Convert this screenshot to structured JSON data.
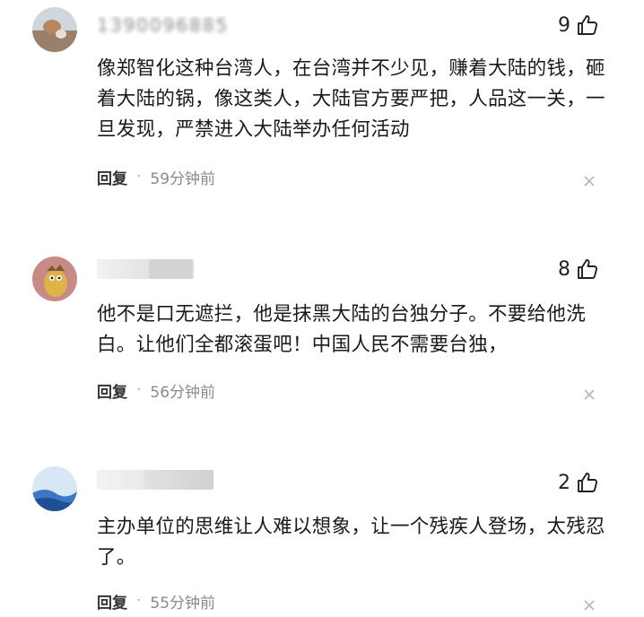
{
  "comments": [
    {
      "username": "1390096885",
      "likes": "9",
      "text": "像郑智化这种台湾人，在台湾并不少见，赚着大陆的钱，砸着大陆的锅，像这类人，大陆官方要严把，人品这一关，一旦发现，严禁进入大陆举办任何活动",
      "reply_label": "回复",
      "separator": "·",
      "time": "59分钟前"
    },
    {
      "username": "",
      "likes": "8",
      "text": "他不是口无遮拦，他是抹黑大陆的台独分子。不要给他洗白。让他们全都滚蛋吧！中国人民不需要台独，",
      "reply_label": "回复",
      "separator": "·",
      "time": "56分钟前"
    },
    {
      "username": "",
      "likes": "2",
      "text": "主办单位的思维让人难以想象，让一个残疾人登场，太残忍了。",
      "reply_label": "回复",
      "separator": "·",
      "time": "55分钟前"
    }
  ],
  "icons": {
    "like": "thumb-up-icon",
    "dismiss": "close-icon",
    "avatar": "avatar"
  }
}
